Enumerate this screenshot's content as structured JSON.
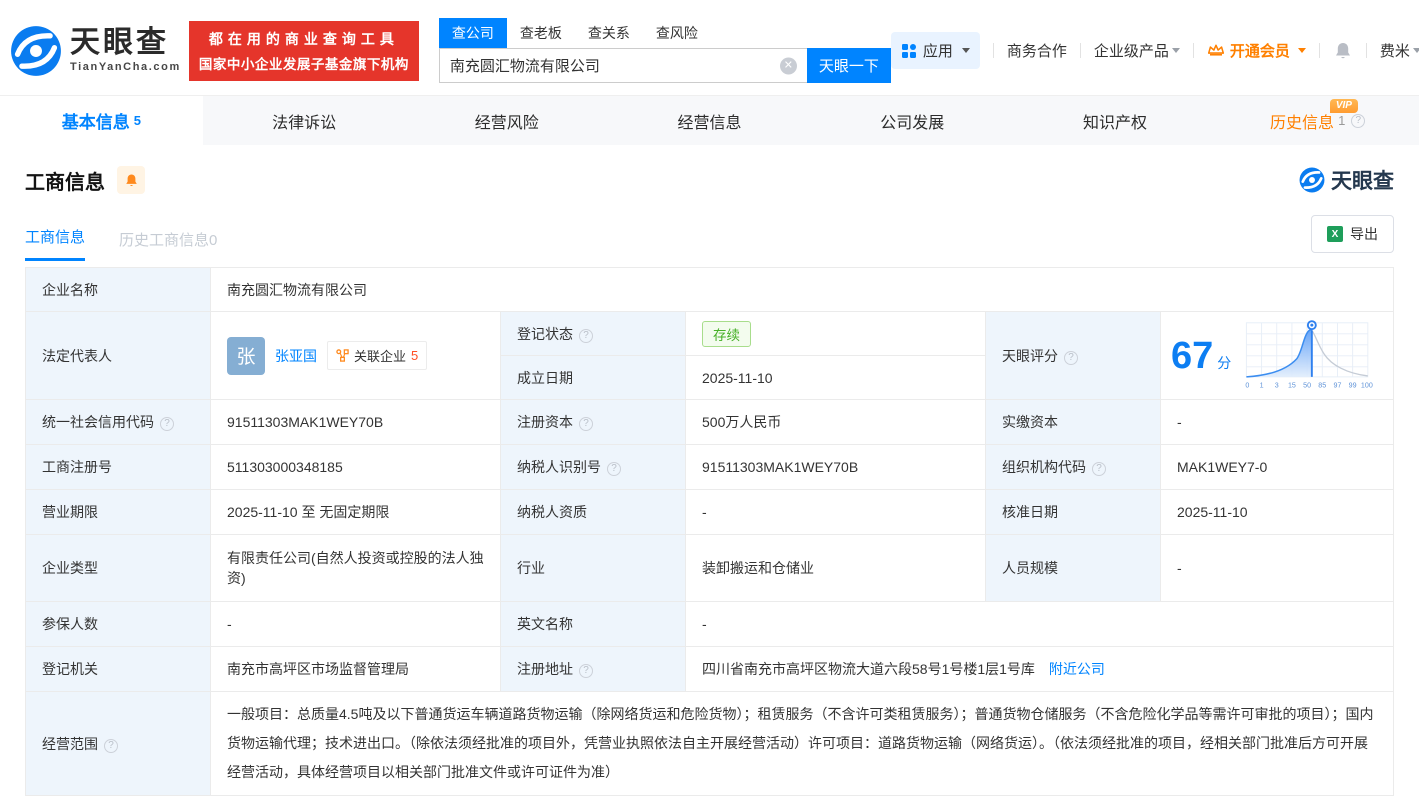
{
  "brand": {
    "name": "天眼查",
    "domain": "TianYanCha.com",
    "slogan_line1": "都在用的商业查询工具",
    "slogan_line2": "国家中小企业发展子基金旗下机构"
  },
  "search": {
    "tabs": [
      {
        "label": "查公司"
      },
      {
        "label": "查老板"
      },
      {
        "label": "查关系"
      },
      {
        "label": "查风险"
      }
    ],
    "value": "南充圆汇物流有限公司",
    "button_label": "天眼一下"
  },
  "topnav": {
    "apps": "应用",
    "biz_coop": "商务合作",
    "enterprise_products": "企业级产品",
    "open_vip": "开通会员",
    "username": "费米"
  },
  "page_tabs": [
    {
      "label": "基本信息",
      "count": "5"
    },
    {
      "label": "法律诉讼",
      "count": ""
    },
    {
      "label": "经营风险",
      "count": ""
    },
    {
      "label": "经营信息",
      "count": ""
    },
    {
      "label": "公司发展",
      "count": ""
    },
    {
      "label": "知识产权",
      "count": ""
    },
    {
      "label": "历史信息",
      "count": "1",
      "badge": "VIP"
    }
  ],
  "section": {
    "title": "工商信息",
    "watermark": "天眼查",
    "subtab_active": "工商信息",
    "subtab_history": "历史工商信息0",
    "export_label": "导出"
  },
  "info": {
    "company_name": {
      "label": "企业名称",
      "value": "南充圆汇物流有限公司"
    },
    "legal_rep": {
      "label": "法定代表人",
      "avatar": "张",
      "name": "张亚国",
      "related_label": "关联企业",
      "related_count": "5"
    },
    "reg_status": {
      "label": "登记状态",
      "value": "存续"
    },
    "establish_date": {
      "label": "成立日期",
      "value": "2025-11-10"
    },
    "tyc_score": {
      "label": "天眼评分"
    },
    "credit_code": {
      "label": "统一社会信用代码",
      "value": "91511303MAK1WEY70B"
    },
    "reg_capital": {
      "label": "注册资本",
      "value": "500万人民币"
    },
    "paid_capital": {
      "label": "实缴资本",
      "value": "-"
    },
    "reg_number": {
      "label": "工商注册号",
      "value": "511303000348185"
    },
    "taxpayer_id": {
      "label": "纳税人识别号",
      "value": "91511303MAK1WEY70B"
    },
    "org_code": {
      "label": "组织机构代码",
      "value": "MAK1WEY7-0"
    },
    "business_term": {
      "label": "营业期限",
      "value": "2025-11-10 至 无固定期限"
    },
    "taxpayer_quality": {
      "label": "纳税人资质",
      "value": "-"
    },
    "approval_date": {
      "label": "核准日期",
      "value": "2025-11-10"
    },
    "company_type": {
      "label": "企业类型",
      "value": "有限责任公司(自然人投资或控股的法人独资)"
    },
    "industry": {
      "label": "行业",
      "value": "装卸搬运和仓储业"
    },
    "staff_size": {
      "label": "人员规模",
      "value": "-"
    },
    "insured_count": {
      "label": "参保人数",
      "value": "-"
    },
    "english_name": {
      "label": "英文名称",
      "value": "-"
    },
    "reg_authority": {
      "label": "登记机关",
      "value": "南充市高坪区市场监督管理局"
    },
    "reg_address": {
      "label": "注册地址",
      "value": "四川省南充市高坪区物流大道六段58号1号楼1层1号库",
      "nearby_link": "附近公司"
    },
    "business_scope": {
      "label": "经营范围",
      "value": "一般项目：总质量4.5吨及以下普通货运车辆道路货物运输（除网络货运和危险货物）；租赁服务（不含许可类租赁服务）；普通货物仓储服务（不含危险化学品等需许可审批的项目）；国内货物运输代理；技术进出口。（除依法须经批准的项目外，凭营业执照依法自主开展经营活动）许可项目：道路货物运输（网络货运）。（依法须经批准的项目，经相关部门批准后方可开展经营活动，具体经营项目以相关部门批准文件或许可证件为准）"
    }
  },
  "chart_data": {
    "type": "area",
    "title": "天眼评分",
    "score": "67",
    "score_unit": "分",
    "x_labels": [
      "0",
      "1",
      "3",
      "15",
      "50",
      "85",
      "97",
      "99",
      "100"
    ],
    "marker_value": 67,
    "xlabel": "",
    "ylabel": "",
    "grid": true
  },
  "colors": {
    "primary_blue": "#0084ff",
    "banner_red": "#e5352b",
    "vip_orange": "#ff8000",
    "tag_green": "#47b028",
    "label_cell_bg": "#eef5fc"
  }
}
